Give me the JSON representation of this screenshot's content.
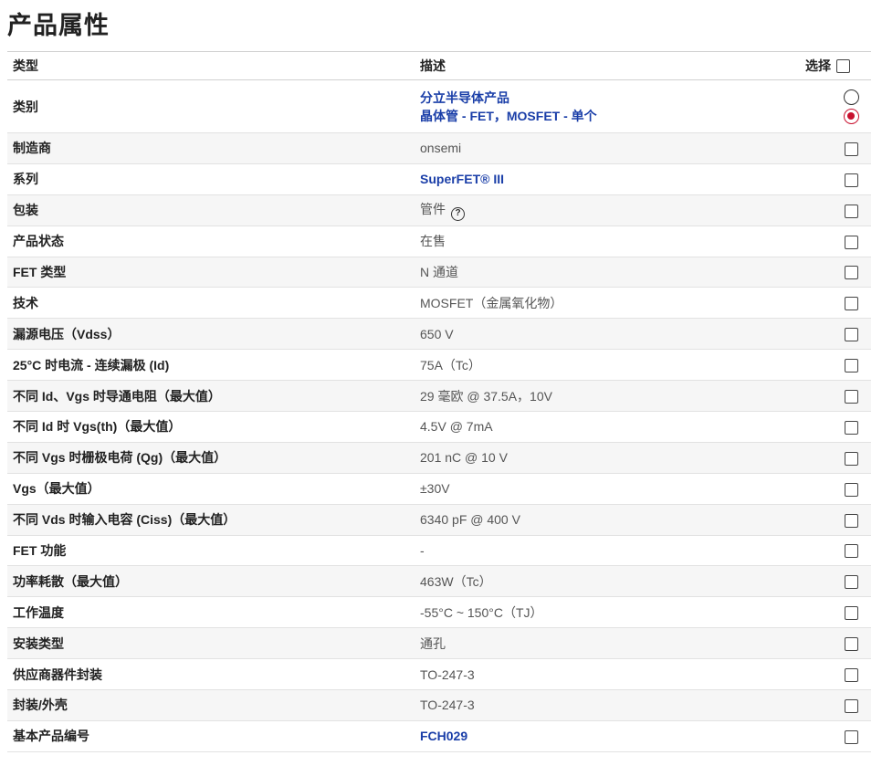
{
  "page": {
    "title": "产品属性"
  },
  "table": {
    "headers": {
      "type": "类型",
      "description": "描述",
      "select": "选择"
    },
    "category_row": {
      "attr": "类别",
      "line1": "分立半导体产品",
      "line2": "晶体管 - FET，MOSFET - 单个"
    },
    "rows": [
      {
        "attr": "制造商",
        "value": "onsemi"
      },
      {
        "attr": "系列",
        "value": "SuperFET® III",
        "link": true
      },
      {
        "attr": "包装",
        "value": "管件",
        "help": "?"
      },
      {
        "attr": "产品状态",
        "value": "在售"
      },
      {
        "attr": "FET 类型",
        "value": "N 通道"
      },
      {
        "attr": "技术",
        "value": "MOSFET（金属氧化物）"
      },
      {
        "attr": "漏源电压（Vdss）",
        "value": "650 V"
      },
      {
        "attr": "25°C 时电流 - 连续漏极 (Id)",
        "value": "75A（Tc）"
      },
      {
        "attr": "不同 Id、Vgs 时导通电阻（最大值）",
        "value": "29 毫欧 @ 37.5A，10V"
      },
      {
        "attr": "不同 Id 时 Vgs(th)（最大值）",
        "value": "4.5V @ 7mA"
      },
      {
        "attr": "不同 Vgs 时栅极电荷 (Qg)（最大值）",
        "value": "201 nC @ 10 V"
      },
      {
        "attr": "Vgs（最大值）",
        "value": "±30V"
      },
      {
        "attr": "不同 Vds 时输入电容 (Ciss)（最大值）",
        "value": "6340 pF @ 400 V"
      },
      {
        "attr": "FET 功能",
        "value": "-"
      },
      {
        "attr": "功率耗散（最大值）",
        "value": "463W（Tc）"
      },
      {
        "attr": "工作温度",
        "value": "-55°C ~ 150°C（TJ）"
      },
      {
        "attr": "安装类型",
        "value": "通孔"
      },
      {
        "attr": "供应商器件封装",
        "value": "TO-247-3"
      },
      {
        "attr": "封装/外壳",
        "value": "TO-247-3"
      },
      {
        "attr": "基本产品编号",
        "value": "FCH029",
        "link": true
      }
    ]
  },
  "colors": {
    "link": "#1a3ea8",
    "radio_selected": "#c8102e",
    "row_alt": "#f6f6f6"
  }
}
